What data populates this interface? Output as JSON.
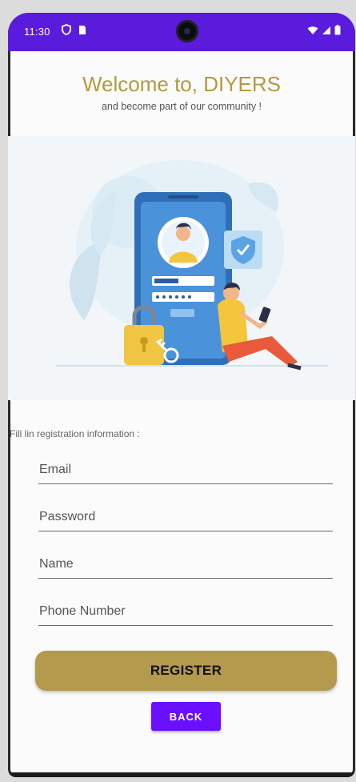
{
  "status_bar": {
    "time": "11:30",
    "icons": [
      "shield-icon",
      "sim-card-icon",
      "wifi-icon",
      "signal-icon",
      "battery-icon"
    ],
    "background": "#5b1bdc"
  },
  "header": {
    "title": "Welcome to, DIYERS",
    "subtitle": "and become part of our community !",
    "title_color": "#b39a3f"
  },
  "form": {
    "intro": "Fill lin registration information :",
    "fields": [
      {
        "placeholder": "Email",
        "value": ""
      },
      {
        "placeholder": "Password",
        "value": ""
      },
      {
        "placeholder": "Name",
        "value": ""
      },
      {
        "placeholder": "Phone Number",
        "value": ""
      }
    ],
    "register_label": "REGISTER",
    "back_label": "BACK",
    "register_color": "#b39a4d",
    "back_color": "#6a0fff"
  }
}
